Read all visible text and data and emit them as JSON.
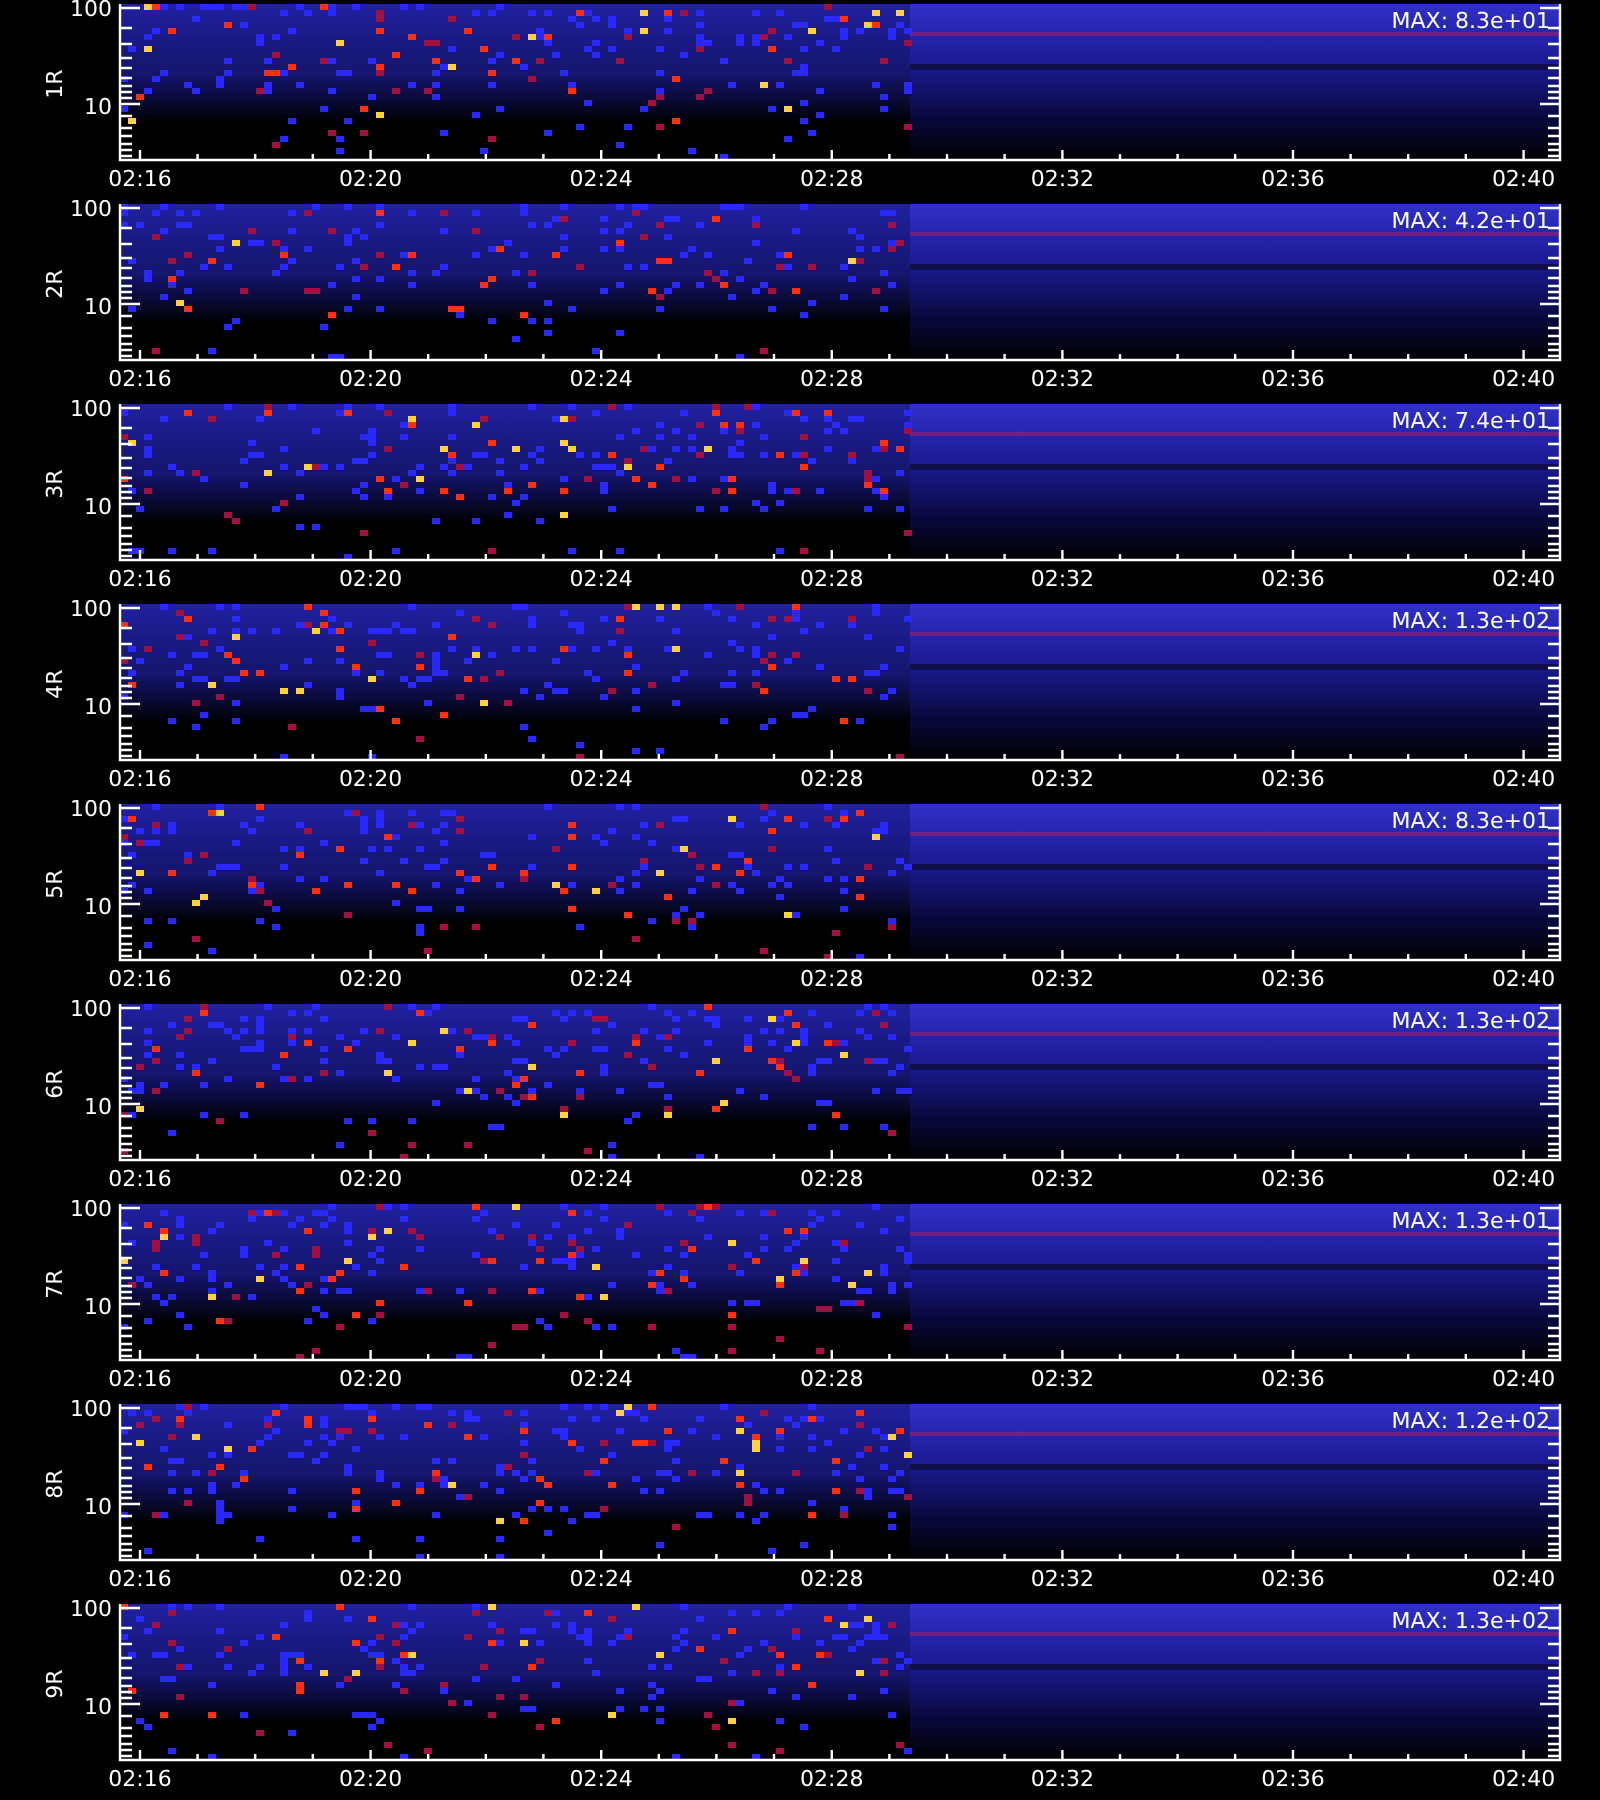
{
  "panels": [
    {
      "label": "1R",
      "max": "MAX: 8.3e+01",
      "y_ticks": [
        "100",
        "10"
      ],
      "x_ticks": [
        "02:16",
        "02:20",
        "02:24",
        "02:28",
        "02:32",
        "02:36",
        "02:40"
      ]
    },
    {
      "label": "2R",
      "max": "MAX: 4.2e+01",
      "y_ticks": [
        "100",
        "10"
      ],
      "x_ticks": [
        "02:16",
        "02:20",
        "02:24",
        "02:28",
        "02:32",
        "02:36",
        "02:40"
      ]
    },
    {
      "label": "3R",
      "max": "MAX: 7.4e+01",
      "y_ticks": [
        "100",
        "10"
      ],
      "x_ticks": [
        "02:16",
        "02:20",
        "02:24",
        "02:28",
        "02:32",
        "02:36",
        "02:40"
      ]
    },
    {
      "label": "4R",
      "max": "MAX: 1.3e+02",
      "y_ticks": [
        "100",
        "10"
      ],
      "x_ticks": [
        "02:16",
        "02:20",
        "02:24",
        "02:28",
        "02:32",
        "02:36",
        "02:40"
      ]
    },
    {
      "label": "5R",
      "max": "MAX: 8.3e+01",
      "y_ticks": [
        "100",
        "10"
      ],
      "x_ticks": [
        "02:16",
        "02:20",
        "02:24",
        "02:28",
        "02:32",
        "02:36",
        "02:40"
      ]
    },
    {
      "label": "6R",
      "max": "MAX: 1.3e+02",
      "y_ticks": [
        "100",
        "10"
      ],
      "x_ticks": [
        "02:16",
        "02:20",
        "02:24",
        "02:28",
        "02:32",
        "02:36",
        "02:40"
      ]
    },
    {
      "label": "7R",
      "max": "MAX: 1.3e+01",
      "y_ticks": [
        "100",
        "10"
      ],
      "x_ticks": [
        "02:16",
        "02:20",
        "02:24",
        "02:28",
        "02:32",
        "02:36",
        "02:40"
      ]
    },
    {
      "label": "8R",
      "max": "MAX: 1.2e+02",
      "y_ticks": [
        "100",
        "10"
      ],
      "x_ticks": [
        "02:16",
        "02:20",
        "02:24",
        "02:28",
        "02:32",
        "02:36",
        "02:40"
      ]
    },
    {
      "label": "9R",
      "max": "MAX: 1.3e+02",
      "y_ticks": [
        "100",
        "10"
      ],
      "x_ticks": [
        "02:16",
        "02:20",
        "02:24",
        "02:28",
        "02:32",
        "02:36",
        "02:40"
      ]
    }
  ]
}
